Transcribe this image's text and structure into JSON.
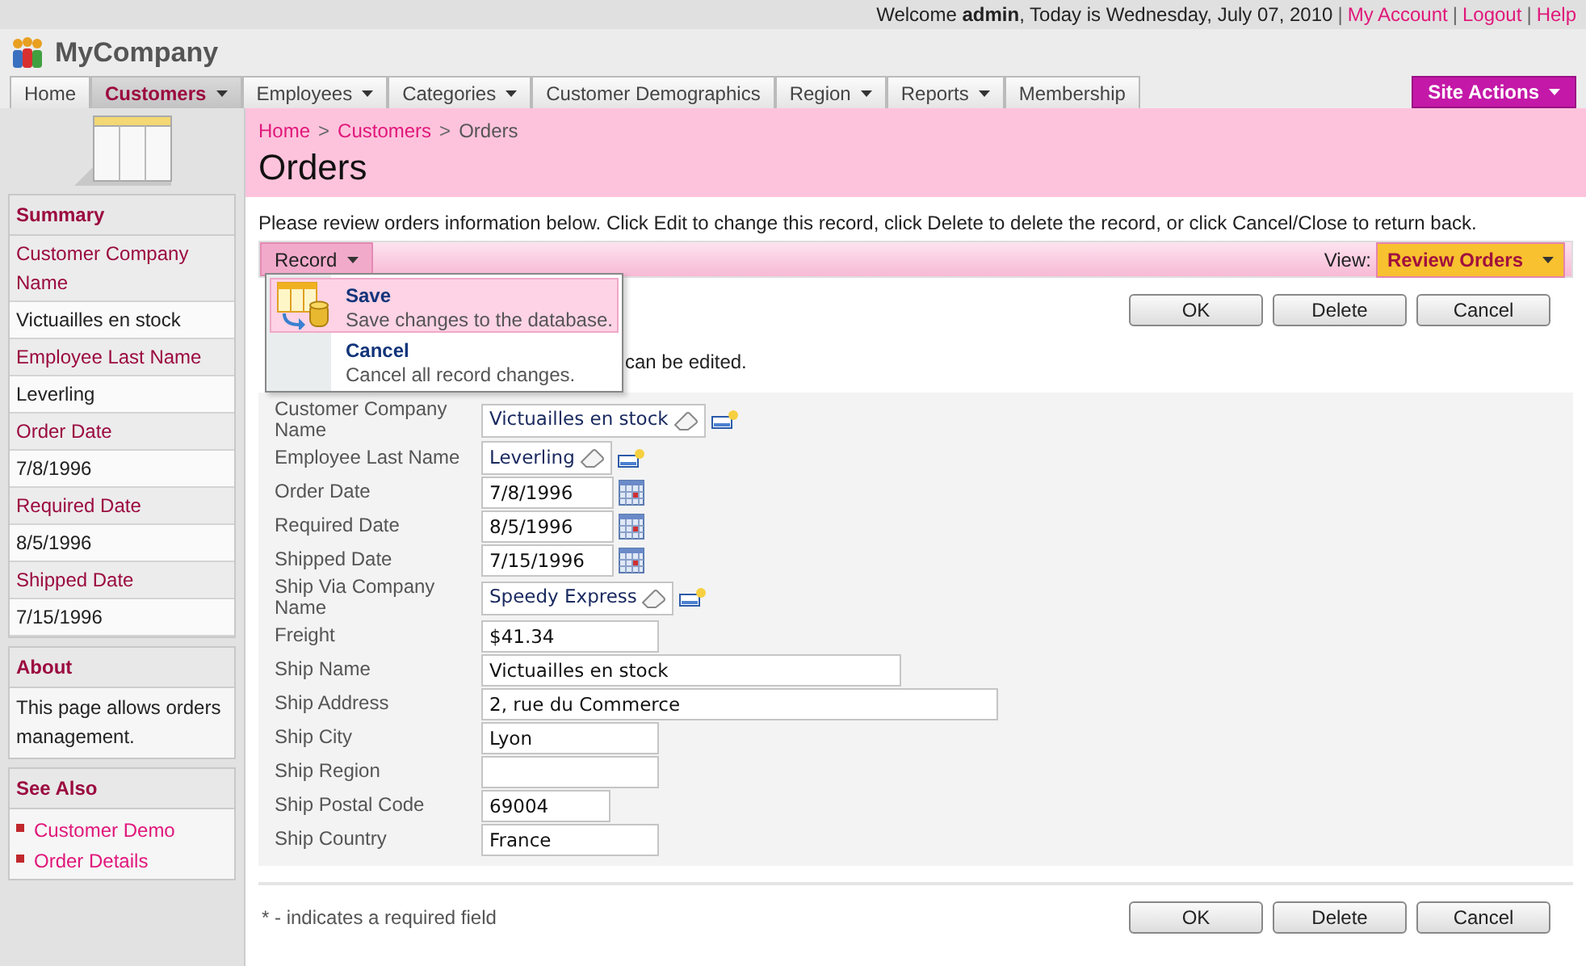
{
  "top_bar": [
    {
      "kind": "text",
      "text": "Welcome **admin**, Today is Wednesday, July 07, 2010"
    },
    {
      "kind": "separator",
      "text": "|"
    },
    {
      "kind": "link",
      "text": "My Account"
    },
    {
      "kind": "separator",
      "text": "|"
    },
    {
      "kind": "link",
      "text": "Logout"
    },
    {
      "kind": "separator",
      "text": "|"
    },
    {
      "kind": "link",
      "text": "Help"
    }
  ],
  "logo": {
    "text": "MyCompany"
  },
  "nav": {
    "tabs": [
      {
        "label": "Home",
        "dropdown": false,
        "selected": false
      },
      {
        "label": "Customers",
        "dropdown": true,
        "selected": true
      },
      {
        "label": "Employees",
        "dropdown": true,
        "selected": false
      },
      {
        "label": "Categories",
        "dropdown": true,
        "selected": false
      },
      {
        "label": "Customer Demographics",
        "dropdown": false,
        "selected": false
      },
      {
        "label": "Region",
        "dropdown": true,
        "selected": false
      },
      {
        "label": "Reports",
        "dropdown": true,
        "selected": false
      },
      {
        "label": "Membership",
        "dropdown": false,
        "selected": false
      }
    ],
    "site_actions": {
      "label": "Site Actions",
      "dropdown": true
    }
  },
  "sidebar": {
    "summary": {
      "title": "Summary",
      "fields": [
        {
          "label": "Customer Company Name",
          "value": "Victuailles en stock"
        },
        {
          "label": "Employee Last Name",
          "value": "Leverling"
        },
        {
          "label": "Order Date",
          "value": "7/8/1996"
        },
        {
          "label": "Required Date",
          "value": "8/5/1996"
        },
        {
          "label": "Shipped Date",
          "value": "7/15/1996"
        }
      ]
    },
    "about": {
      "title": "About",
      "text": "This page allows orders management."
    },
    "see_also": {
      "title": "See Also",
      "links": [
        "Customer Demo",
        "Order Details"
      ]
    }
  },
  "breadcrumb": [
    {
      "kind": "link",
      "text": "Home"
    },
    {
      "kind": "separator",
      "text": ">"
    },
    {
      "kind": "link",
      "text": "Customers"
    },
    {
      "kind": "separator",
      "text": ">"
    },
    {
      "kind": "current",
      "text": "Orders"
    }
  ],
  "page_title": "Orders",
  "instructions": "Please review orders information below. Click Edit to change this record, click Delete to delete the record, or click Cancel/Close to return back.",
  "toolbar": {
    "record_menu": {
      "label": "Record",
      "expanded": true,
      "items": [
        {
          "title": "Save",
          "description": "Save changes to the database.",
          "has_icon": true,
          "selected": true
        },
        {
          "title": "Cancel",
          "description": "Cancel all record changes.",
          "has_icon": false,
          "selected": false
        }
      ]
    },
    "view_label": "View:",
    "view": "Review Orders"
  },
  "buttons": [
    "OK",
    "Delete",
    "Cancel"
  ],
  "partial_note": "can be edited.",
  "form": [
    {
      "label": "Customer Company Name",
      "kind": "lookup",
      "value": "Victuailles en stock"
    },
    {
      "label": "Employee Last Name",
      "kind": "lookup",
      "value": "Leverling"
    },
    {
      "label": "Order Date",
      "kind": "date",
      "value": "7/8/1996"
    },
    {
      "label": "Required Date",
      "kind": "date",
      "value": "8/5/1996"
    },
    {
      "label": "Shipped Date",
      "kind": "date",
      "value": "7/15/1996"
    },
    {
      "label": "Ship Via Company Name",
      "kind": "lookup",
      "value": "Speedy Express"
    },
    {
      "label": "Freight",
      "kind": "short",
      "value": "$41.34"
    },
    {
      "label": "Ship Name",
      "kind": "long",
      "value": "Victuailles en stock"
    },
    {
      "label": "Ship Address",
      "kind": "wide",
      "value": "2, rue du Commerce"
    },
    {
      "label": "Ship City",
      "kind": "short",
      "value": "Lyon"
    },
    {
      "label": "Ship Region",
      "kind": "short"
    },
    {
      "label": "Ship Postal Code",
      "kind": "tiny",
      "value": "69004"
    },
    {
      "label": "Ship Country",
      "kind": "short",
      "value": "France"
    }
  ],
  "footer_note": "* - indicates a required field",
  "footer_buttons": [
    "OK",
    "Delete",
    "Cancel"
  ]
}
